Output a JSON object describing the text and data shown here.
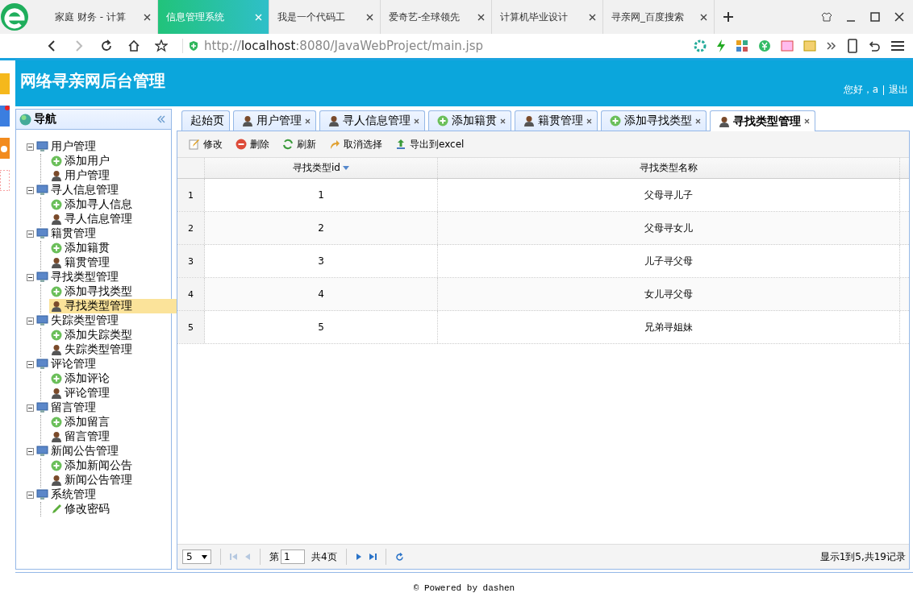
{
  "browser": {
    "tabs": [
      {
        "title": "家庭 财务 - 计算",
        "selected": false
      },
      {
        "title": "信息管理系统",
        "selected": true
      },
      {
        "title": "我是一个代码工",
        "selected": false
      },
      {
        "title": "爱奇艺-全球领先",
        "selected": false
      },
      {
        "title": "计算机毕业设计",
        "selected": false
      },
      {
        "title": "寻亲网_百度搜索",
        "selected": false
      }
    ],
    "url": "http://**localhost**:8080/JavaWebProject/main.jsp"
  },
  "header": {
    "title": "网络寻亲网后台管理",
    "greeting": "您好，a",
    "logout": "退出"
  },
  "nav": {
    "title": "导航",
    "groups": [
      {
        "label": "用户管理",
        "expanded": true,
        "children": [
          {
            "label": "添加用户",
            "kind": "add",
            "selected": false
          },
          {
            "label": "用户管理",
            "kind": "user",
            "selected": false
          }
        ]
      },
      {
        "label": "寻人信息管理",
        "expanded": true,
        "children": [
          {
            "label": "添加寻人信息",
            "kind": "add",
            "selected": false
          },
          {
            "label": "寻人信息管理",
            "kind": "user",
            "selected": false
          }
        ]
      },
      {
        "label": "籍贯管理",
        "expanded": true,
        "children": [
          {
            "label": "添加籍贯",
            "kind": "add",
            "selected": false
          },
          {
            "label": "籍贯管理",
            "kind": "user",
            "selected": false
          }
        ]
      },
      {
        "label": "寻找类型管理",
        "expanded": true,
        "children": [
          {
            "label": "添加寻找类型",
            "kind": "add",
            "selected": false
          },
          {
            "label": "寻找类型管理",
            "kind": "user",
            "selected": true
          }
        ]
      },
      {
        "label": "失踪类型管理",
        "expanded": true,
        "children": [
          {
            "label": "添加失踪类型",
            "kind": "add",
            "selected": false
          },
          {
            "label": "失踪类型管理",
            "kind": "user",
            "selected": false
          }
        ]
      },
      {
        "label": "评论管理",
        "expanded": true,
        "children": [
          {
            "label": "添加评论",
            "kind": "add",
            "selected": false
          },
          {
            "label": "评论管理",
            "kind": "user",
            "selected": false
          }
        ]
      },
      {
        "label": "留言管理",
        "expanded": true,
        "children": [
          {
            "label": "添加留言",
            "kind": "add",
            "selected": false
          },
          {
            "label": "留言管理",
            "kind": "user",
            "selected": false
          }
        ]
      },
      {
        "label": "新闻公告管理",
        "expanded": true,
        "children": [
          {
            "label": "添加新闻公告",
            "kind": "add",
            "selected": false
          },
          {
            "label": "新闻公告管理",
            "kind": "user",
            "selected": false
          }
        ]
      },
      {
        "label": "系统管理",
        "expanded": true,
        "children": [
          {
            "label": "修改密码",
            "kind": "edit",
            "selected": false
          }
        ]
      }
    ]
  },
  "tabs": [
    {
      "label": "起始页",
      "kind": "none",
      "closable": false,
      "selected": false
    },
    {
      "label": "用户管理",
      "kind": "user",
      "closable": true,
      "selected": false
    },
    {
      "label": "寻人信息管理",
      "kind": "user",
      "closable": true,
      "selected": false
    },
    {
      "label": "添加籍贯",
      "kind": "add",
      "closable": true,
      "selected": false
    },
    {
      "label": "籍贯管理",
      "kind": "user",
      "closable": true,
      "selected": false
    },
    {
      "label": "添加寻找类型",
      "kind": "add",
      "closable": true,
      "selected": false
    },
    {
      "label": "寻找类型管理",
      "kind": "user",
      "closable": true,
      "selected": true
    }
  ],
  "toolbar": [
    {
      "label": "修改",
      "kind": "edit"
    },
    {
      "label": "删除",
      "kind": "delete"
    },
    {
      "label": "刷新",
      "kind": "refresh"
    },
    {
      "label": "取消选择",
      "kind": "undo"
    },
    {
      "label": "导出到excel",
      "kind": "export"
    }
  ],
  "table": {
    "columns": [
      {
        "label": "寻找类型id",
        "sorted": true
      },
      {
        "label": "寻找类型名称",
        "sorted": false
      }
    ],
    "rows": [
      {
        "number": "1",
        "cells": [
          "1",
          "父母寻儿子"
        ]
      },
      {
        "number": "2",
        "cells": [
          "2",
          "父母寻女儿"
        ]
      },
      {
        "number": "3",
        "cells": [
          "3",
          "儿子寻父母"
        ]
      },
      {
        "number": "4",
        "cells": [
          "4",
          "女儿寻父母"
        ]
      },
      {
        "number": "5",
        "cells": [
          "5",
          "兄弟寻姐妹"
        ]
      }
    ]
  },
  "pager": {
    "page_size": "5",
    "page_prefix": "第",
    "page": "1",
    "total_pages": "共4页",
    "summary": "显示1到5,共19记录"
  },
  "footer": "© Powered by dashen"
}
